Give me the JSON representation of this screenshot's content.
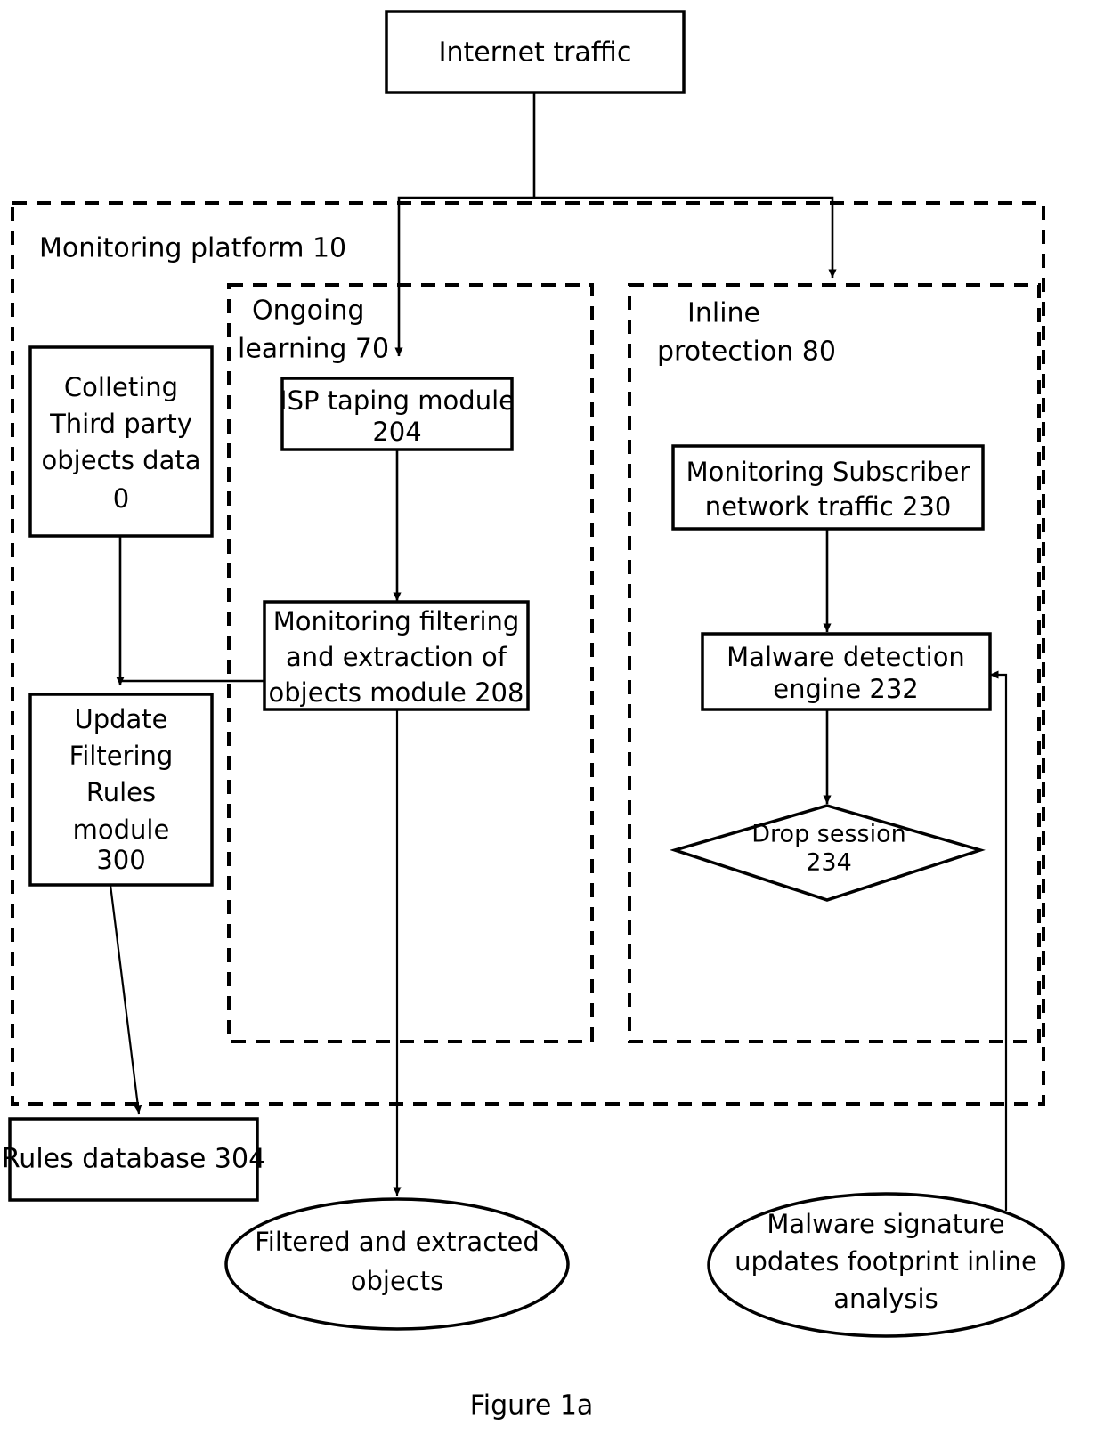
{
  "figure": {
    "caption": "Figure 1a"
  },
  "nodes": {
    "internet_traffic": {
      "label": "Internet traffic",
      "shape": "rect"
    },
    "collecting": {
      "lines": [
        "Colleting",
        "Third party",
        "objects data",
        "0"
      ],
      "shape": "rect"
    },
    "update_filtering": {
      "lines": [
        "Update",
        "Filtering",
        "Rules",
        "module",
        "300"
      ],
      "shape": "rect"
    },
    "rules_database": {
      "label": "Rules database 304",
      "shape": "rect"
    },
    "isp_taping": {
      "lines": [
        "ISP taping module",
        "204"
      ],
      "shape": "rect"
    },
    "monitoring_filtering": {
      "lines": [
        "Monitoring filtering",
        "and extraction of",
        "objects module 208"
      ],
      "shape": "rect"
    },
    "monitoring_subscriber": {
      "lines": [
        "Monitoring Subscriber",
        "network traffic 230"
      ],
      "shape": "rect"
    },
    "malware_engine": {
      "lines": [
        "Malware detection",
        "engine 232"
      ],
      "shape": "rect"
    },
    "drop_session": {
      "lines": [
        "Drop session",
        "234"
      ],
      "shape": "diamond"
    },
    "filtered_objects": {
      "lines": [
        "Filtered and extracted",
        "objects"
      ],
      "shape": "ellipse"
    },
    "malware_signature": {
      "lines": [
        "Malware signature",
        "updates footprint inline",
        "analysis"
      ],
      "shape": "ellipse"
    }
  },
  "groups": {
    "monitoring_platform": {
      "label": "Monitoring platform 10",
      "style": "dashed"
    },
    "ongoing_learning": {
      "lines": [
        "Ongoing",
        "learning 70"
      ],
      "style": "dashed"
    },
    "inline_protection": {
      "lines": [
        "Inline",
        "protection 80"
      ],
      "style": "dashed"
    }
  },
  "colors": {
    "stroke": "#000000",
    "fill": "#ffffff",
    "text": "#000000"
  }
}
